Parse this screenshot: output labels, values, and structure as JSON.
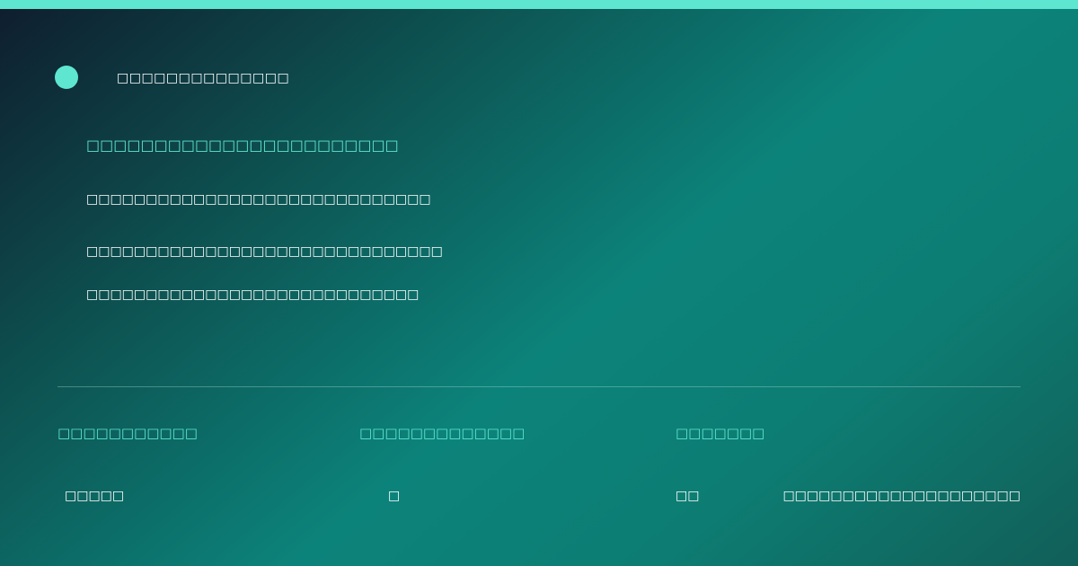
{
  "brand": {
    "name": "□□□□□□□□□□□□□□",
    "accent_color": "#5ee6d0"
  },
  "hero": {
    "headline": "□□□□□□□□□□□□□□□□□□□□□□□",
    "lines": [
      "□□□□□□□□□□□□□□□□□□□□□□□□□□□□□",
      "□□□□□□□□□□□□□□□□□□□□□□□□□□□□□□",
      "□□□□□□□□□□□□□□□□□□□□□□□□□□□□"
    ]
  },
  "stats": [
    {
      "label": "□□□□□□□□□□□",
      "value": "□□□□□"
    },
    {
      "label": "□□□□□□□□□□□□□",
      "value": "□"
    },
    {
      "label": "□□□□□□□",
      "value": "□□"
    }
  ],
  "footer": {
    "note": "□□□□□□□□□□□□□□□□□□□□"
  }
}
